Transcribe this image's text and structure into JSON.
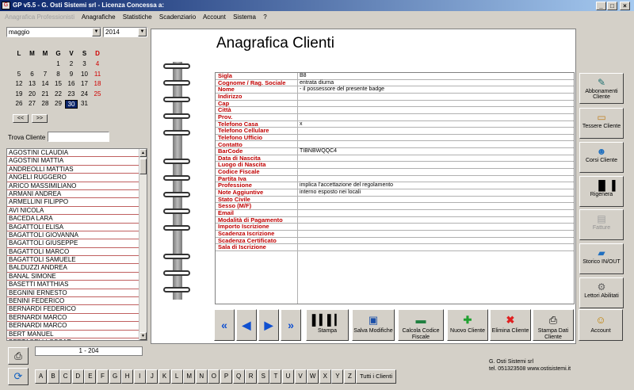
{
  "window": {
    "title": "GP v5.5  -  G. Osti Sistemi srl  -  Licenza Concessa a:"
  },
  "menu": {
    "items": [
      "Anagrafica Professionisti",
      "Anagrafiche",
      "Statistiche",
      "Scadenziario",
      "Account",
      "Sistema",
      "?"
    ]
  },
  "calendar": {
    "month": "maggio",
    "year": "2014",
    "weekdays": [
      "L",
      "M",
      "M",
      "G",
      "V",
      "S",
      "D"
    ],
    "weeks": [
      [
        "",
        "",
        "",
        "1",
        "2",
        "3",
        "4"
      ],
      [
        "5",
        "6",
        "7",
        "8",
        "9",
        "10",
        "11"
      ],
      [
        "12",
        "13",
        "14",
        "15",
        "16",
        "17",
        "18"
      ],
      [
        "19",
        "20",
        "21",
        "22",
        "23",
        "24",
        "25"
      ],
      [
        "26",
        "27",
        "28",
        "29",
        "30",
        "31",
        ""
      ]
    ],
    "selected_day": "30",
    "prev_label": "<<",
    "next_label": ">>"
  },
  "search": {
    "label": "Trova Cliente",
    "value": ""
  },
  "clients": [
    "AGOSTINI CLAUDIA",
    "AGOSTINI MATTIA",
    "ANDREOLLI MATTIAS",
    "ANGELI RUGGERO",
    "ARICO MASSIMILIANO",
    "ARMANI ANDREA",
    "ARMELLINI FILIPPO",
    "AVI NICOLA",
    "BACEDA LARA",
    "BAGATTOLI ELISA",
    "BAGATTOLI GIOVANNA",
    "BAGATTOLI GIUSEPPE",
    "BAGATTOLI MARCO",
    "BAGATTOLI SAMUELE",
    "BALDUZZI ANDREA",
    "BANAL SIMONE",
    "BASETTI MATTHIAS",
    "BEGNINI ERNESTO",
    "BENINI FEDERICO",
    "BERNARDI FEDERICO",
    "BERNARDI MARCO",
    "BERNARDI MARCO",
    "BERT MANUEL",
    "BERTAGELLI OSCAR"
  ],
  "list_count": "1 - 204",
  "main": {
    "title": "Anagrafica Clienti",
    "fields": [
      {
        "label": "Sigla",
        "value": "B8"
      },
      {
        "label": "Cognome / Rag. Sociale",
        "value": "entrata diurna"
      },
      {
        "label": "Nome",
        "value": "- il possessore del presente badge"
      },
      {
        "label": "Indirizzo",
        "value": ""
      },
      {
        "label": "Cap",
        "value": ""
      },
      {
        "label": "Città",
        "value": ""
      },
      {
        "label": "Prov.",
        "value": ""
      },
      {
        "label": "Telefono Casa",
        "value": "x"
      },
      {
        "label": "Telefono Cellulare",
        "value": ""
      },
      {
        "label": "Telefono Ufficio",
        "value": ""
      },
      {
        "label": "Contatto",
        "value": ""
      },
      {
        "label": "BarCode",
        "value": "TIBNBWQQC4"
      },
      {
        "label": "Data di Nascita",
        "value": ""
      },
      {
        "label": "Luogo di Nascita",
        "value": ""
      },
      {
        "label": "Codice Fiscale",
        "value": ""
      },
      {
        "label": "Partita Iva",
        "value": ""
      },
      {
        "label": "Professione",
        "value": "implica l'accettazione del regolamento"
      },
      {
        "label": "Note Aggiuntive",
        "value": "interno esposto nei locali"
      },
      {
        "label": "Stato Civile",
        "value": ""
      },
      {
        "label": "Sesso (M/F)",
        "value": ""
      },
      {
        "label": "Email",
        "value": ""
      },
      {
        "label": "Modalità di Pagamento",
        "value": ""
      },
      {
        "label": "Importo Iscrizione",
        "value": ""
      },
      {
        "label": "Scadenza Iscrizione",
        "value": ""
      },
      {
        "label": "Scadenza Certificato",
        "value": ""
      },
      {
        "label": "Sala di Iscrizione",
        "value": ""
      }
    ]
  },
  "side_buttons": [
    {
      "label": "Abbonamenti Cliente",
      "icon": "subscription-icon"
    },
    {
      "label": "Tessere Cliente",
      "icon": "card-icon"
    },
    {
      "label": "Corsi Cliente",
      "icon": "people-icon"
    },
    {
      "label": "Rigenera",
      "icon": "barcode-icon"
    },
    {
      "label": "Fatture",
      "icon": "invoice-icon"
    },
    {
      "label": "Storico IN/OUT",
      "icon": "folder-icon"
    },
    {
      "label": "Lettori Abilitati",
      "icon": "readers-icon"
    }
  ],
  "bottom_buttons": {
    "stampa": "Stampa",
    "salva": "Salva Modifiche",
    "calcola": "Calcola Codice Fiscale",
    "nuovo": "Nuovo Cliente",
    "elimina": "Elimina Cliente",
    "stampa_dati": "Stampa Dati Cliente",
    "account": "Account"
  },
  "letters": [
    "A",
    "B",
    "C",
    "D",
    "E",
    "F",
    "G",
    "H",
    "I",
    "J",
    "K",
    "L",
    "M",
    "N",
    "O",
    "P",
    "Q",
    "R",
    "S",
    "T",
    "U",
    "V",
    "W",
    "X",
    "Y",
    "Z"
  ],
  "tutti": "Tutti i Clienti",
  "company": {
    "name": "G. Osti Sistemi srl",
    "contact": "tel. 051323508 www.ostisistemi.it"
  }
}
